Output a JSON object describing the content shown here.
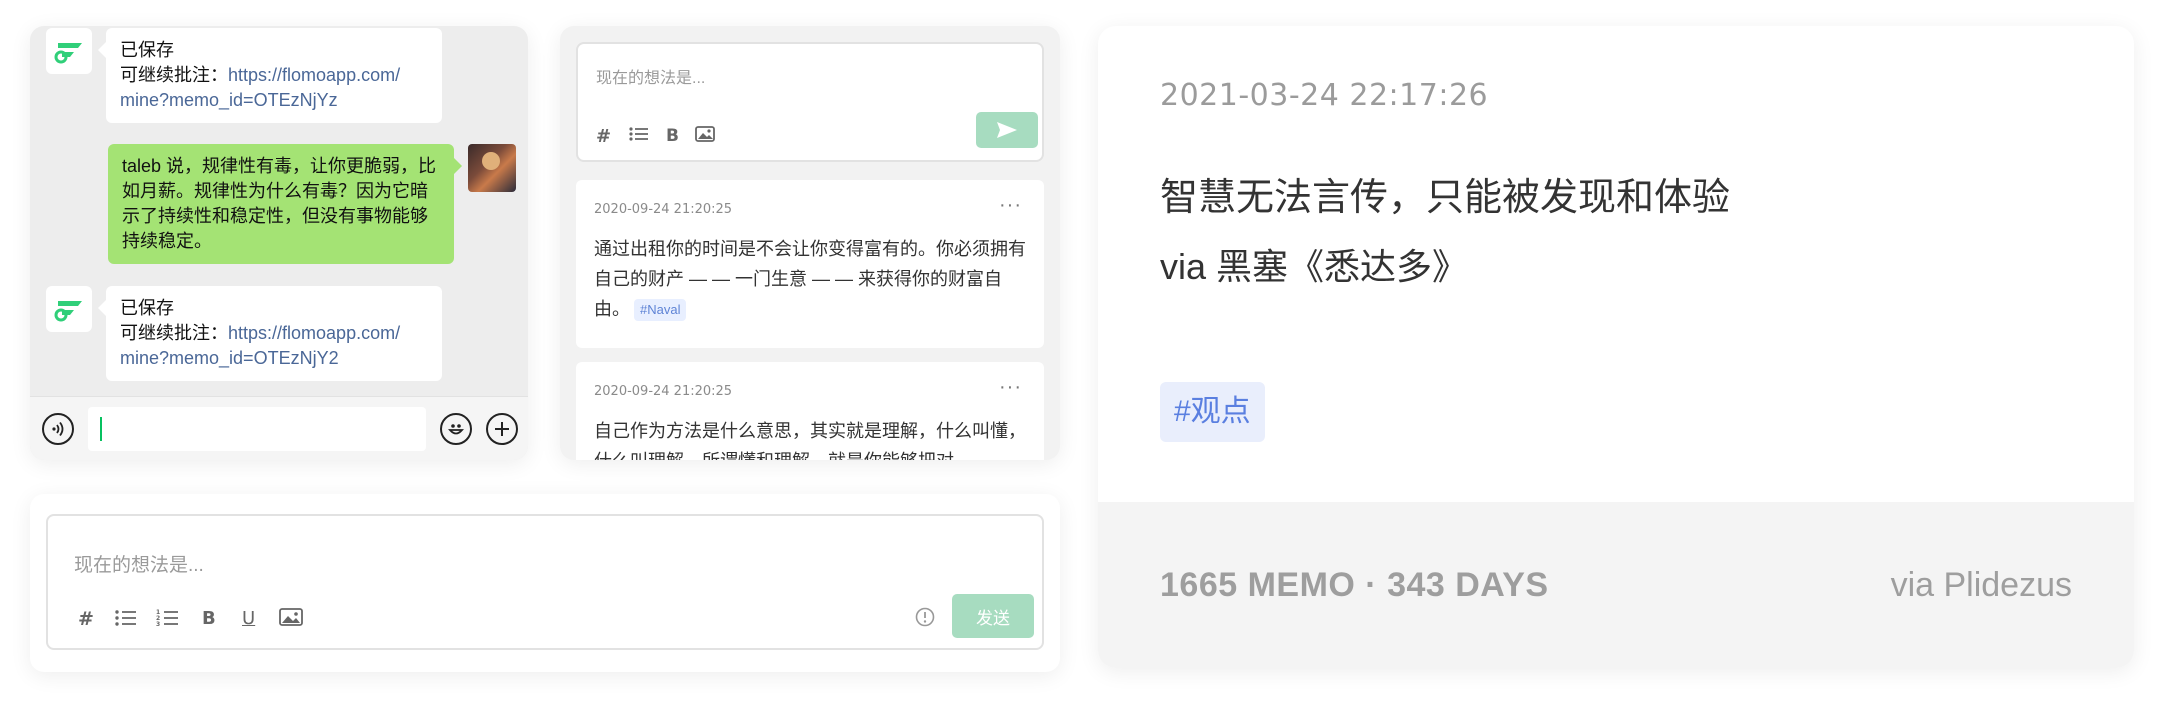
{
  "chat": {
    "messages": [
      {
        "from": "bot",
        "line1": "已保存",
        "line2_prefix": "可继续批注：",
        "link_part1": "https://flomoapp.com/",
        "link_part2": "mine?memo_id=OTEzNjYz"
      },
      {
        "from": "user",
        "text": "taleb 说，规律性有毒，让你更脆弱，比如月薪。规律性为什么有毒？因为它暗示了持续性和稳定性，但没有事物能够持续稳定。"
      },
      {
        "from": "bot",
        "line1": "已保存",
        "line2_prefix": "可继续批注：",
        "link_part1": "https://flomoapp.com/",
        "link_part2": "mine?memo_id=OTEzNjY2"
      }
    ],
    "icons": {
      "voice": "voice-icon",
      "emoji": "emoji-icon",
      "add": "add-icon",
      "logo": "flomo-logo-icon"
    }
  },
  "memo_editor": {
    "placeholder": "现在的想法是...",
    "toolbar": [
      "#",
      "list",
      "B",
      "image"
    ],
    "send_icon": "send-icon"
  },
  "memos": [
    {
      "time": "2020-09-24 21:20:25",
      "more": "···",
      "text": "通过出租你的时间是不会让你变得富有的。你必须拥有自己的财产 — — 一门生意 — — 来获得你的财富自由。",
      "tag": "#Naval"
    },
    {
      "time": "2020-09-24 21:20:25",
      "more": "···",
      "text": "自己作为方法是什么意思，其实就是理解，什么叫懂，什么叫理解，所谓懂和理解，就是你能够把对"
    }
  ],
  "bottom_editor": {
    "placeholder": "现在的想法是...",
    "tools": {
      "hash": "#",
      "bold": "B",
      "underline": "U"
    },
    "info_icon": "info-icon",
    "send_label": "发送"
  },
  "share_card": {
    "date": "2021-03-24 22:17:26",
    "quote": "智慧无法言传，只能被发现和体验",
    "source": "via 黑塞《悉达多》",
    "tag": "#观点",
    "stats": "1665 MEMO · 343 DAYS",
    "via": "via Plidezus"
  },
  "colors": {
    "brand_green": "#30cf79",
    "wechat_green": "#a4e374",
    "link": "#4a6797",
    "tag_blue": "#5a7fe0",
    "send_disabled": "#a7dcc0"
  }
}
